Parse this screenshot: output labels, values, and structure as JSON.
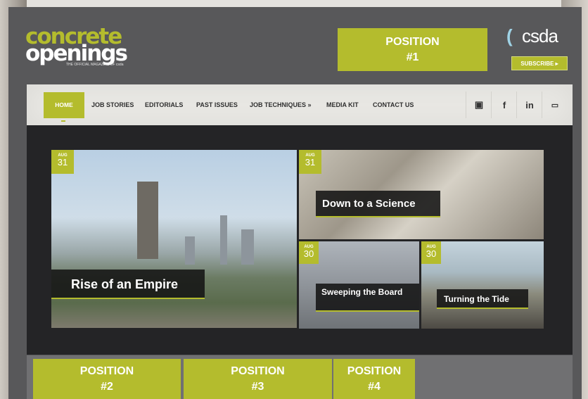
{
  "brand": {
    "logo_line1": "concrete",
    "logo_line2": "openings",
    "tagline": "THE OFFICIAL MAGAZINE OF csda",
    "partner_logo": "csda",
    "subscribe_label": "SUBSCRIBE ▸",
    "accent_color": "#b4bc2d"
  },
  "ads": {
    "pos1": {
      "line1": "POSITION",
      "line2": "#1"
    },
    "pos2": {
      "line1": "POSITION",
      "line2": "#2"
    },
    "pos3": {
      "line1": "POSITION",
      "line2": "#3"
    },
    "pos4": {
      "line1": "POSITION",
      "line2": "#4"
    }
  },
  "nav": {
    "items": [
      "HOME",
      "JOB STORIES",
      "EDITORIALS",
      "PAST ISSUES",
      "JOB TECHNIQUES »",
      "MEDIA KIT",
      "CONTACT US"
    ],
    "social": [
      {
        "icon": "instagram-icon",
        "glyph": "▣"
      },
      {
        "icon": "facebook-icon",
        "glyph": "f"
      },
      {
        "icon": "linkedin-icon",
        "glyph": "in"
      },
      {
        "icon": "youtube-icon",
        "glyph": "▭"
      }
    ]
  },
  "stories": [
    {
      "title": "Rise of an Empire",
      "month": "AUG",
      "day": "31"
    },
    {
      "title": "Down to a Science",
      "month": "AUG",
      "day": "31"
    },
    {
      "title": "Sweeping the Board",
      "month": "AUG",
      "day": "30"
    },
    {
      "title": "Turning the Tide",
      "month": "AUG",
      "day": "30"
    }
  ]
}
